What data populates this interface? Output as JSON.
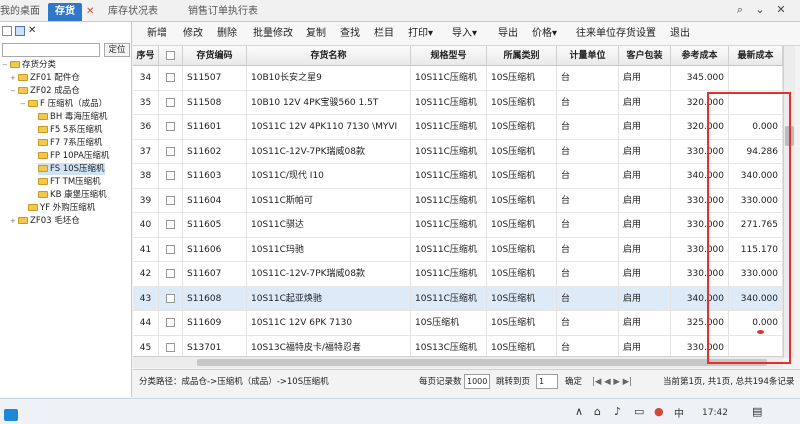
{
  "tabs": {
    "desktop": "我的桌面",
    "inventory": "存货",
    "inventory_close": "✕",
    "stock_report": "库存状况表",
    "sales_order": "销售订单执行表"
  },
  "tree": {
    "locate_button": "定位",
    "items": [
      "存货分类",
      "ZF01 配件仓",
      "ZF02 成品仓",
      "F 压缩机（成品）",
      "BH 毒海压缩机",
      "F5 5系压缩机",
      "F7 7系压缩机",
      "FP 10PA压缩机",
      "FS 10S压缩机",
      "FT TM压缩机",
      "KB 康堡压缩机",
      "YF 外购压缩机",
      "ZF03 毛坯仓"
    ]
  },
  "toolbar": [
    "新增",
    "修改",
    "删除",
    "批量修改",
    "复制",
    "查找",
    "栏目",
    "打印▾",
    "导入▾",
    "导出",
    "价格▾",
    "往来单位存货设置",
    "退出"
  ],
  "table": {
    "columns": [
      "序号",
      "",
      "存货编码",
      "存货名称",
      "规格型号",
      "所属类别",
      "计量单位",
      "客户包装",
      "参考成本",
      "最新成本"
    ],
    "rows": [
      {
        "no": "34",
        "code": "S11507",
        "name": "10B10长安之星9",
        "spec": "10S11C压缩机",
        "cat": "10S压缩机",
        "unit": "台",
        "pack": "启用",
        "ref": "345.000",
        "latest": ""
      },
      {
        "no": "35",
        "code": "S11508",
        "name": "10B10 12V 4PK宝骏560 1.5T",
        "spec": "10S11C压缩机",
        "cat": "10S压缩机",
        "unit": "台",
        "pack": "启用",
        "ref": "320.000",
        "latest": ""
      },
      {
        "no": "36",
        "code": "S11601",
        "name": "10S11C 12V 4PK110 7130 \\MYVI",
        "spec": "10S11C压缩机",
        "cat": "10S压缩机",
        "unit": "台",
        "pack": "启用",
        "ref": "320.000",
        "latest": "0.000"
      },
      {
        "no": "37",
        "code": "S11602",
        "name": "10S11C-12V-7PK瑞威08款",
        "spec": "10S11C压缩机",
        "cat": "10S压缩机",
        "unit": "台",
        "pack": "启用",
        "ref": "330.000",
        "latest": "94.286"
      },
      {
        "no": "38",
        "code": "S11603",
        "name": "10S11C/现代 I10",
        "spec": "10S11C压缩机",
        "cat": "10S压缩机",
        "unit": "台",
        "pack": "启用",
        "ref": "340.000",
        "latest": "340.000"
      },
      {
        "no": "39",
        "code": "S11604",
        "name": "10S11C斯帕可",
        "spec": "10S11C压缩机",
        "cat": "10S压缩机",
        "unit": "台",
        "pack": "启用",
        "ref": "330.000",
        "latest": "330.000"
      },
      {
        "no": "40",
        "code": "S11605",
        "name": "10S11C骐达",
        "spec": "10S11C压缩机",
        "cat": "10S压缩机",
        "unit": "台",
        "pack": "启用",
        "ref": "330.000",
        "latest": "271.765"
      },
      {
        "no": "41",
        "code": "S11606",
        "name": "10S11C玛驰",
        "spec": "10S11C压缩机",
        "cat": "10S压缩机",
        "unit": "台",
        "pack": "启用",
        "ref": "330.000",
        "latest": "115.170"
      },
      {
        "no": "42",
        "code": "S11607",
        "name": "10S11C-12V-7PK瑞威08款",
        "spec": "10S11C压缩机",
        "cat": "10S压缩机",
        "unit": "台",
        "pack": "启用",
        "ref": "330.000",
        "latest": "330.000"
      },
      {
        "no": "43",
        "code": "S11608",
        "name": "10S11C起亚焕驰",
        "spec": "10S11C压缩机",
        "cat": "10S压缩机",
        "unit": "台",
        "pack": "启用",
        "ref": "340.000",
        "latest": "340.000"
      },
      {
        "no": "44",
        "code": "S11609",
        "name": "10S11C 12V 6PK 7130",
        "spec": "10S压缩机",
        "cat": "10S压缩机",
        "unit": "台",
        "pack": "启用",
        "ref": "325.000",
        "latest": "0.000"
      },
      {
        "no": "45",
        "code": "S13701",
        "name": "10S13C福特皮卡/福特忍者",
        "spec": "10S13C压缩机",
        "cat": "10S压缩机",
        "unit": "台",
        "pack": "启用",
        "ref": "330.000",
        "latest": ""
      },
      {
        "no": "46",
        "code": "S13703",
        "name": "10S13C 12V 6PK 凌派",
        "spec": "10S13C压缩机",
        "cat": "10S压缩机",
        "unit": "台",
        "pack": "启用",
        "ref": "325.000",
        "latest": ""
      },
      {
        "no": "47",
        "code": "S13704",
        "name": "10S13C-12V-4PK135/12-14款威驰",
        "spec": "10S13C压缩机",
        "cat": "10S压缩机",
        "unit": "台",
        "pack": "启用",
        "ref": "330.000",
        "latest": "128.473"
      }
    ]
  },
  "status": {
    "path": "分类路径：成品仓->压缩机（成品）->10S压缩机",
    "per_page_label": "每页记录数",
    "per_page": "1000",
    "jump_label": "跳转到页",
    "jump_page": "1",
    "confirm": "确定",
    "nav": "|◀  ◀  ▶  ▶|",
    "summary": "当前第1页, 共1页, 总共194条记录"
  },
  "taskbar": {
    "time": "17:42",
    "ime": "中"
  },
  "colors": {
    "accent": "#2f77c8",
    "annotation": "#e2322b"
  }
}
